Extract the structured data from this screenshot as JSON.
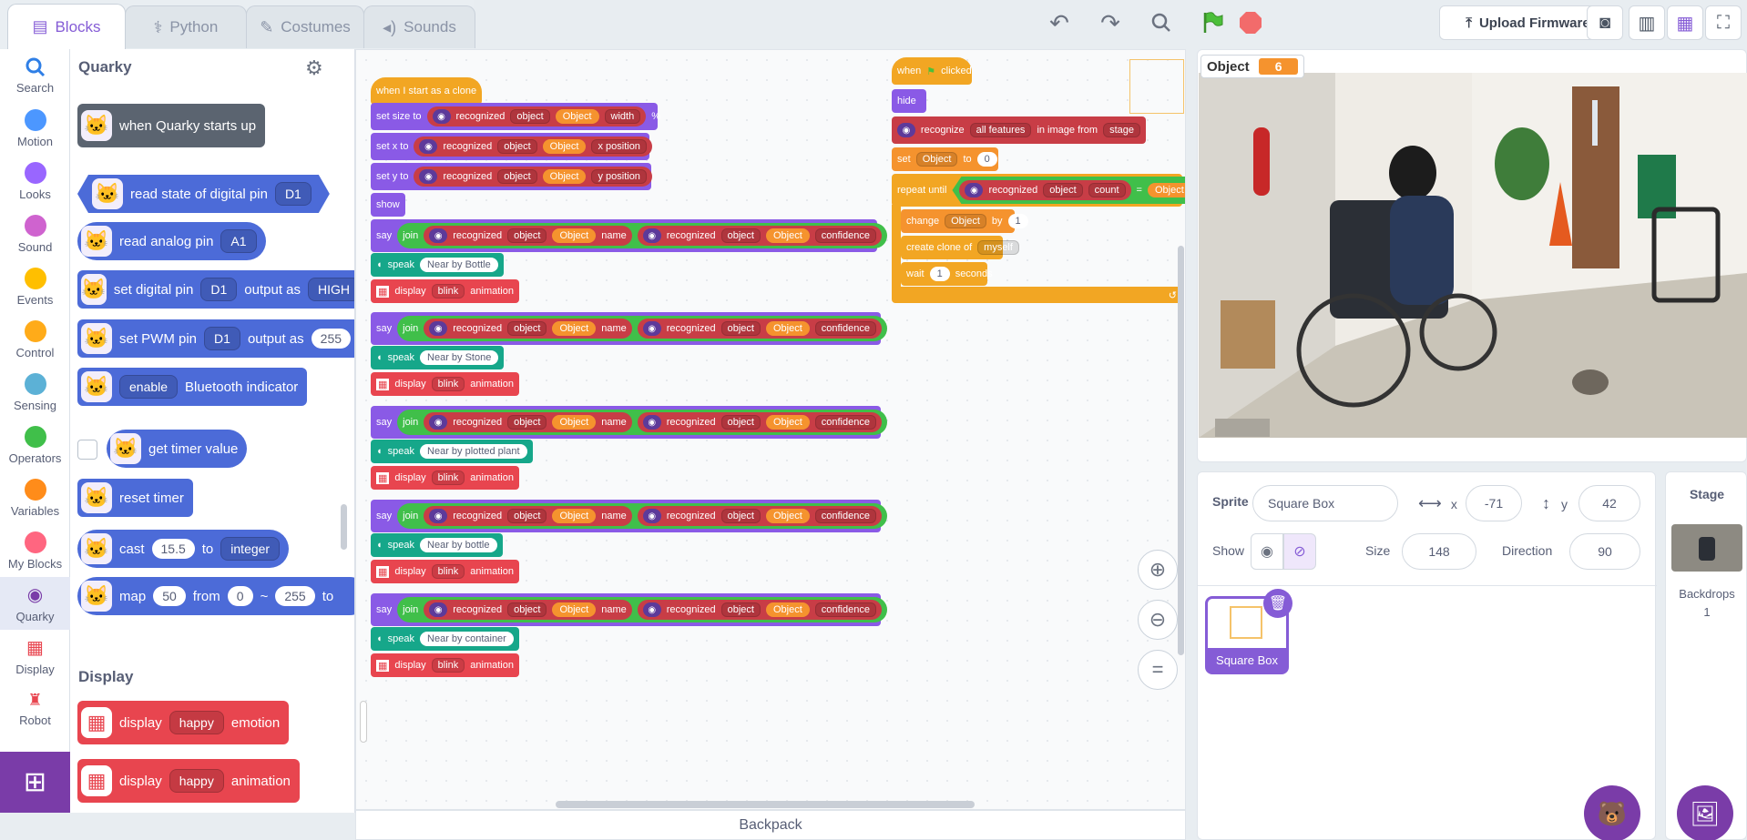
{
  "tabs": [
    {
      "label": "Blocks",
      "icon": "blocks-icon"
    },
    {
      "label": "Python",
      "icon": "python-icon"
    },
    {
      "label": "Costumes",
      "icon": "brush-icon"
    },
    {
      "label": "Sounds",
      "icon": "speaker-icon"
    }
  ],
  "toolbar": {
    "upload_label": "Upload Firmware"
  },
  "categories": [
    {
      "label": "Search",
      "color": "#2f7fe6"
    },
    {
      "label": "Motion",
      "color": "#4c97ff"
    },
    {
      "label": "Looks",
      "color": "#9966ff"
    },
    {
      "label": "Sound",
      "color": "#cf63cf"
    },
    {
      "label": "Events",
      "color": "#ffbf00"
    },
    {
      "label": "Control",
      "color": "#ffab19"
    },
    {
      "label": "Sensing",
      "color": "#5cb1d6"
    },
    {
      "label": "Operators",
      "color": "#40bf4a"
    },
    {
      "label": "Variables",
      "color": "#ff8c1a"
    },
    {
      "label": "My Blocks",
      "color": "#ff6680"
    },
    {
      "label": "Quarky",
      "color": "#7a3ca8"
    },
    {
      "label": "Display",
      "color": "#e8454f"
    },
    {
      "label": "Robot",
      "color": "#e8454f"
    }
  ],
  "palette": {
    "heading": "Quarky",
    "display_heading": "Display",
    "b_start": "when Quarky starts up",
    "b_read_digital": "read state of digital pin",
    "b_read_digital_pin": "D1",
    "b_read_analog": "read analog pin",
    "b_read_analog_pin": "A1",
    "b_set_digital": "set digital pin",
    "b_set_digital_pin": "D1",
    "b_output_as": "output as",
    "b_set_digital_val": "HIGH",
    "b_set_pwm": "set PWM pin",
    "b_set_pwm_pin": "D1",
    "b_set_pwm_val": "255",
    "b_enable": "enable",
    "b_bt": "Bluetooth indicator",
    "b_timer": "get timer value",
    "b_reset": "reset timer",
    "b_cast": "cast",
    "b_cast_val": "15.5",
    "b_to": "to",
    "b_cast_type": "integer",
    "b_map": "map",
    "b_map_val": "50",
    "b_from": "from",
    "b_map_a": "0",
    "b_tilde": "~",
    "b_map_b": "255",
    "b_display": "display",
    "b_happy": "happy",
    "b_emotion": "emotion",
    "b_animation": "animation"
  },
  "code": {
    "clone_hat": "when I start as a clone",
    "set_size": "set size to",
    "set_x": "set x to",
    "set_y": "set y to",
    "recognized": "recognized",
    "object_dd": "object",
    "object_pill": "Object",
    "width": "width",
    "percent": "%",
    "x_position": "x position",
    "y_position": "y position",
    "show": "show",
    "say": "say",
    "join": "join",
    "name": "name",
    "confidence": "confidence",
    "speak": "speak",
    "display": "display",
    "blink": "blink",
    "animation": "animation",
    "speak_texts": [
      "Near by Bottle",
      "Near by Stone",
      "Near by plotted plant",
      "Near by bottle",
      "Near by container"
    ],
    "flag_hat_when": "when",
    "flag_hat_clicked": "clicked",
    "hide": "hide",
    "recognize": "recognize",
    "all_features": "all features",
    "in_image_from": "in image from",
    "stage": "stage",
    "set": "set",
    "to": "to",
    "zero": "0",
    "repeat_until": "repeat until",
    "count": "count",
    "eq": "=",
    "change": "change",
    "by": "by",
    "one": "1",
    "create_clone": "create clone of",
    "myself": "myself",
    "wait": "wait",
    "seconds": "seconds"
  },
  "backpack": "Backpack",
  "stage": {
    "var_label": "Object",
    "var_value": "6"
  },
  "sprite": {
    "label": "Sprite",
    "name": "Square Box",
    "x_label": "x",
    "x": "-71",
    "y_label": "y",
    "y": "42",
    "show_label": "Show",
    "size_label": "Size",
    "size": "148",
    "direction_label": "Direction",
    "direction": "90",
    "thumb_label": "Square Box"
  },
  "stage_pane": {
    "label": "Stage",
    "backdrops_label": "Backdrops",
    "backdrops_count": "1"
  }
}
